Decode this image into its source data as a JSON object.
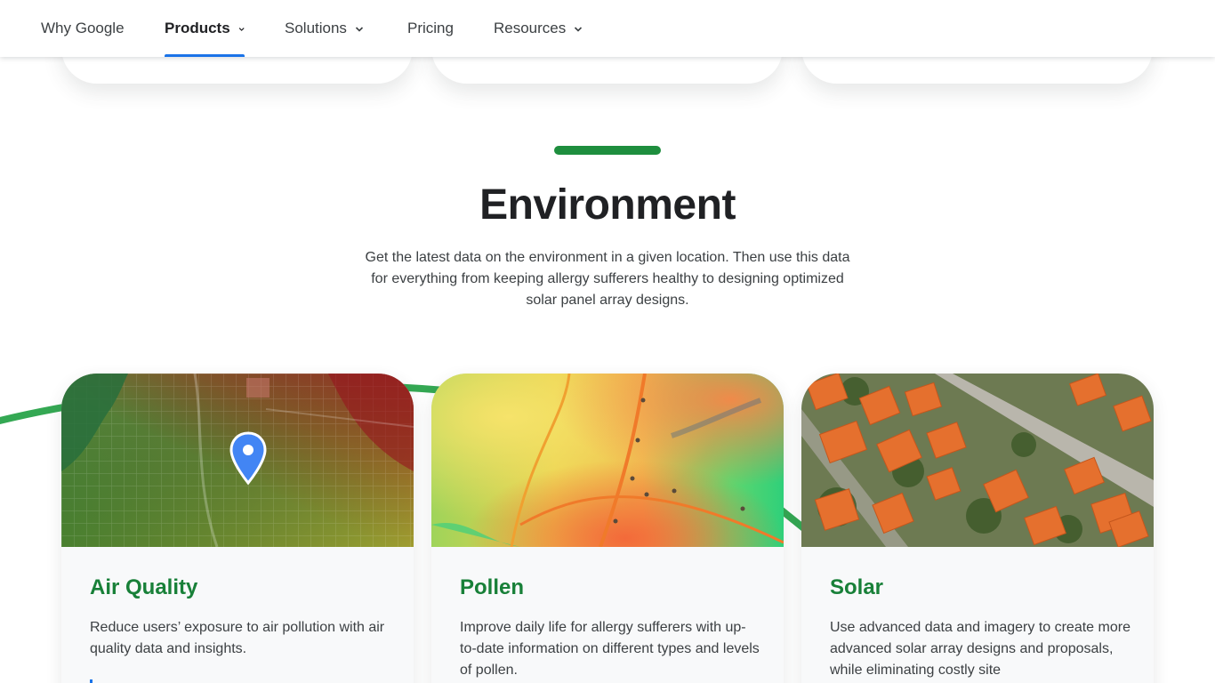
{
  "nav": {
    "items": [
      {
        "label": "Why Google",
        "dropdown": false,
        "active": false
      },
      {
        "label": "Products",
        "dropdown": true,
        "active": true
      },
      {
        "label": "Solutions",
        "dropdown": true,
        "active": false
      },
      {
        "label": "Pricing",
        "dropdown": false,
        "active": false
      },
      {
        "label": "Resources",
        "dropdown": true,
        "active": false
      }
    ]
  },
  "section": {
    "title": "Environment",
    "description": "Get the latest data on the environment in a given location. Then use this data for everything from keeping allergy sufferers healthy to designing optimized solar panel array designs."
  },
  "cards": [
    {
      "title": "Air Quality",
      "description": "Reduce users’ exposure to air pollution with air quality data and insights.",
      "image": "air-quality-map"
    },
    {
      "title": "Pollen",
      "description": "Improve daily life for allergy sufferers with up-to-date information on different types and levels of pollen.",
      "image": "pollen-heatmap"
    },
    {
      "title": "Solar",
      "description": "Use advanced data and imagery to create more advanced solar array designs and proposals, while eliminating costly site",
      "image": "solar-rooftops-aerial"
    }
  ],
  "colors": {
    "accent_green": "#1e8e3e",
    "card_title_green": "#188038",
    "nav_active_blue": "#1a73e8",
    "text": "#3c4043"
  }
}
